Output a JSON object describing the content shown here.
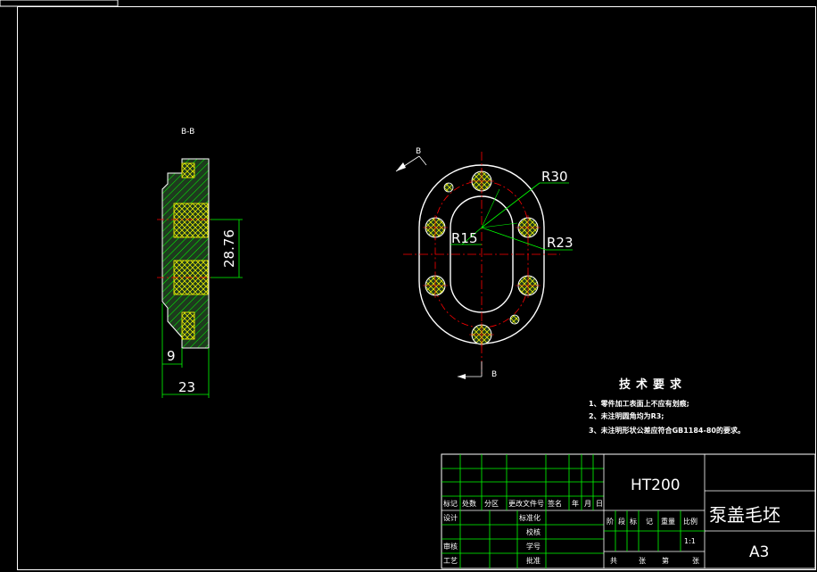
{
  "colors": {
    "background": "#000000",
    "border": "#ffffff",
    "outline": "#ffffff",
    "hatch": "#00ff00",
    "hatch_fill": "#336633",
    "centerline": "#ff0000",
    "leader": "#00ff00",
    "dimension": "#00ff00",
    "hole": "#ffff00",
    "title_grid": "#00ff00"
  },
  "section_view": {
    "label": "B-B",
    "dims": {
      "height": "28.76",
      "step": "9",
      "width": "23"
    }
  },
  "plan_view": {
    "section_marker_top": "B",
    "section_marker_bottom": "B",
    "radii": {
      "r30": "R30",
      "r15": "R15",
      "r23": "R23"
    }
  },
  "tech_requirements": {
    "title": "技术要求",
    "items": [
      "1、零件加工表面上不应有划痕;",
      "2、未注明圆角均为R3;",
      "3、未注明形状公差应符合GB1184-80的要求。"
    ]
  },
  "title_block": {
    "material": "HT200",
    "part_name": "泵盖毛坯",
    "sheet_size": "A3",
    "scale": "1:1",
    "revision_headers": [
      "标记",
      "处数",
      "分区",
      "更改文件号",
      "签名",
      "年",
      "月",
      "日"
    ],
    "design": "设计",
    "standardization": "标准化",
    "review": "审核",
    "craft": "工艺",
    "check": "校核",
    "approve": "批准",
    "number": "学号",
    "stage_headers": [
      "阶",
      "段",
      "标",
      "记",
      "重量",
      "比例"
    ],
    "sheet_total": "共",
    "sheet_unit": "张",
    "sheet_no": "第",
    "sheet_unit2": "张"
  }
}
